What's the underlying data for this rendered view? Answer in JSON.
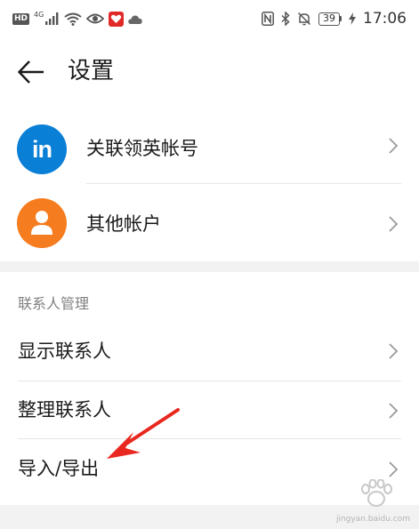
{
  "status_bar": {
    "hd_badge": "HD",
    "network_label": "4G",
    "battery_level": "39",
    "time": "17:06",
    "icons": [
      "signal-icon",
      "wifi-icon",
      "eye-comfort-icon",
      "notification-app-icon",
      "cloud-icon",
      "nfc-icon",
      "bluetooth-icon",
      "mute-icon",
      "battery-icon"
    ]
  },
  "header": {
    "title": "设置"
  },
  "accounts": [
    {
      "label": "关联领英帐号",
      "icon": "linkedin-icon",
      "icon_text": "in",
      "color": "#0a7fd6"
    },
    {
      "label": "其他帐户",
      "icon": "person-icon",
      "color": "#f57c1f"
    }
  ],
  "contacts_section": {
    "header": "联系人管理",
    "items": [
      {
        "label": "显示联系人"
      },
      {
        "label": "整理联系人"
      },
      {
        "label": "导入/导出"
      }
    ]
  },
  "annotation": {
    "arrow_color": "#e8271f"
  },
  "watermark": {
    "text": "jingyan.baidu.com"
  }
}
